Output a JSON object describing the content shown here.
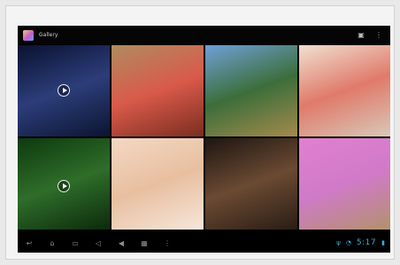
{
  "app": {
    "title": "Gallery",
    "icon": "gallery-app-icon"
  },
  "actionbar": {
    "buttons": [
      {
        "name": "camera-button",
        "icon": "camera-icon",
        "glyph": "▣"
      },
      {
        "name": "overflow-menu-button",
        "icon": "overflow-menu-icon",
        "glyph": "⋮"
      }
    ]
  },
  "gallery": {
    "tiles": [
      {
        "name": "media-tile-1",
        "type": "video",
        "colors": [
          "#0a1230",
          "#2c3d7a",
          "#0b1530"
        ]
      },
      {
        "name": "media-tile-2",
        "type": "photo",
        "colors": [
          "#b08b60",
          "#d95a4a",
          "#7a2d20"
        ]
      },
      {
        "name": "media-tile-3",
        "type": "photo",
        "colors": [
          "#6fa0d8",
          "#3c6e3a",
          "#a48a4c"
        ]
      },
      {
        "name": "media-tile-4",
        "type": "photo",
        "colors": [
          "#f0e0d0",
          "#e07a6a",
          "#d8c8b8"
        ]
      },
      {
        "name": "media-tile-5",
        "type": "video",
        "colors": [
          "#0d3a0d",
          "#2f6d2a",
          "#0c2a0c"
        ]
      },
      {
        "name": "media-tile-6",
        "type": "photo",
        "colors": [
          "#f4d8c2",
          "#e8bfa0",
          "#f6e6da"
        ]
      },
      {
        "name": "media-tile-7",
        "type": "photo",
        "colors": [
          "#1e1612",
          "#6b4a32",
          "#2a1d15"
        ]
      },
      {
        "name": "media-tile-8",
        "type": "photo",
        "colors": [
          "#e080d0",
          "#d07ac8",
          "#b2926c"
        ]
      }
    ]
  },
  "navbar": {
    "buttons": [
      {
        "name": "back-button",
        "icon": "back-icon",
        "glyph": "↩"
      },
      {
        "name": "home-button",
        "icon": "home-icon",
        "glyph": "⌂"
      },
      {
        "name": "recent-apps-button",
        "icon": "recent-apps-icon",
        "glyph": "▭"
      },
      {
        "name": "volume-down-button",
        "icon": "volume-down-icon",
        "glyph": "◁"
      },
      {
        "name": "volume-up-button",
        "icon": "volume-up-icon",
        "glyph": "◀"
      },
      {
        "name": "screenshot-button",
        "icon": "screenshot-icon",
        "glyph": "▦"
      },
      {
        "name": "menu-button",
        "icon": "menu-icon",
        "glyph": "⋮"
      }
    ],
    "status": {
      "clock": "5:17",
      "icons": [
        "usb-icon",
        "wifi-icon",
        "battery-icon"
      ]
    }
  }
}
